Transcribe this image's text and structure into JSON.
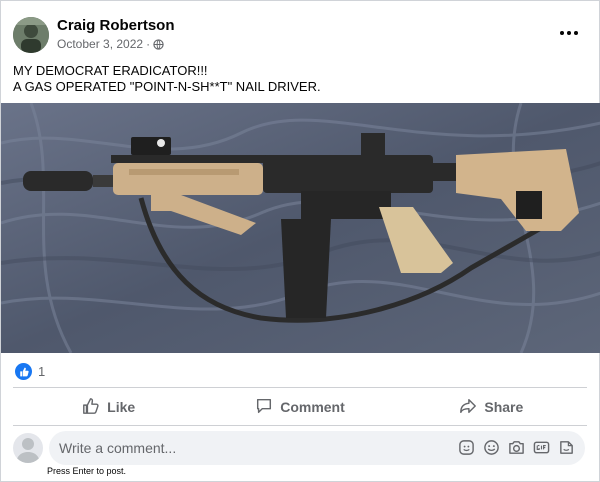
{
  "post": {
    "author": "Craig Robertson",
    "date": "October 3, 2022",
    "separator": "·",
    "line1": "MY DEMOCRAT ERADICATOR!!!",
    "line2": "A GAS OPERATED \"POINT-N-SH**T\" NAIL DRIVER."
  },
  "reactions": {
    "like_count": "1"
  },
  "actions": {
    "like": "Like",
    "comment": "Comment",
    "share": "Share"
  },
  "composer": {
    "placeholder": "Write a comment...",
    "hint": "Press Enter to post."
  },
  "colors": {
    "accent": "#1877f2",
    "secondary_text": "#65676b",
    "input_bg": "#f0f2f5",
    "photo_blanket": "#5a6478",
    "rifle_tan": "#d2b48c",
    "rifle_black": "#2a2a2a"
  },
  "icons": [
    "globe-icon",
    "more-icon",
    "thumbs-up-icon",
    "comment-icon",
    "share-icon",
    "avatar-icon",
    "sticker-icon",
    "emoji-icon",
    "camera-icon",
    "gif-icon",
    "sticker-smile-icon"
  ]
}
